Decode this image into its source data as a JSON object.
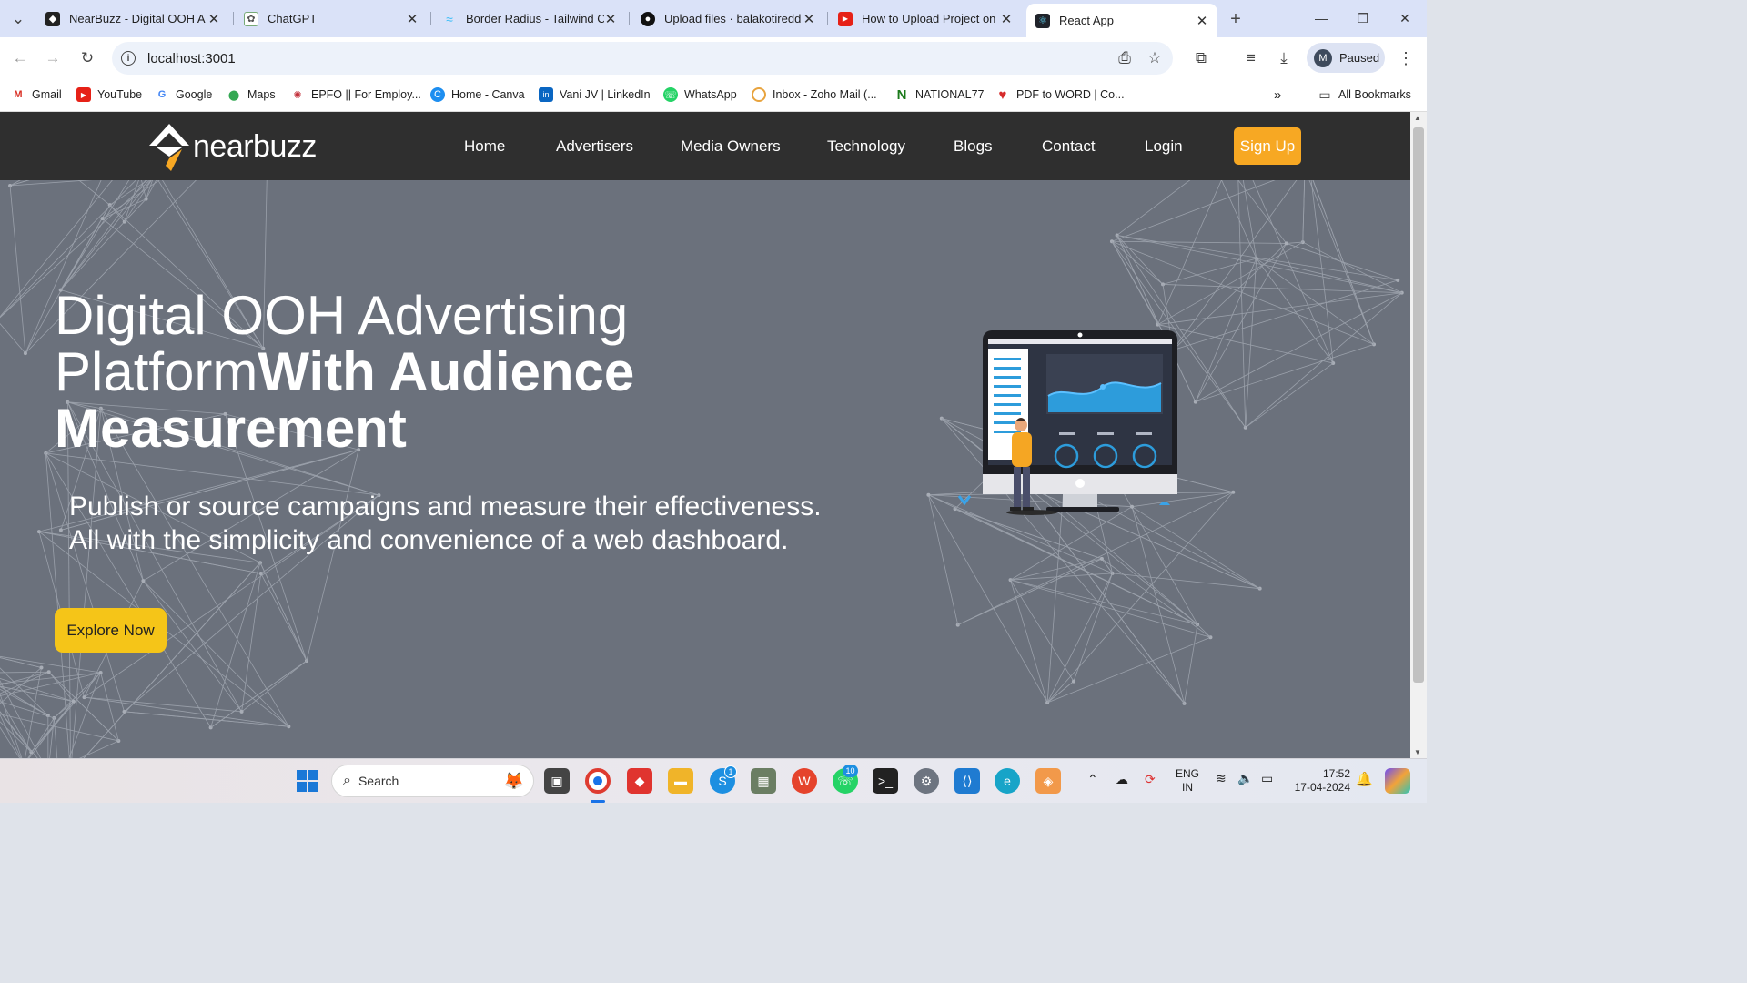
{
  "browser": {
    "tabs": [
      {
        "title": "NearBuzz - Digital OOH A",
        "icon": "nearbuzz-logo-icon"
      },
      {
        "title": "ChatGPT",
        "icon": "chatgpt-icon"
      },
      {
        "title": "Border Radius - Tailwind C",
        "icon": "tailwind-icon"
      },
      {
        "title": "Upload files · balakotiredd",
        "icon": "github-icon"
      },
      {
        "title": "How to Upload Project on",
        "icon": "youtube-icon"
      },
      {
        "title": "React App",
        "icon": "react-icon"
      }
    ],
    "url": "localhost:3001",
    "profile": {
      "initial": "M",
      "status": "Paused"
    },
    "bookmarks": [
      "Gmail",
      "YouTube",
      "Google",
      "Maps",
      "EPFO || For Employ...",
      "Home - Canva",
      "Vani JV | LinkedIn",
      "WhatsApp",
      "Inbox - Zoho Mail (...",
      "NATIONAL77",
      "PDF to WORD | Co..."
    ],
    "all_bookmarks": "All Bookmarks"
  },
  "site": {
    "logo_text": "nearbuzz",
    "nav": [
      "Home",
      "Advertisers",
      "Media Owners",
      "Technology",
      "Blogs",
      "Contact",
      "Login"
    ],
    "signup": "Sign Up",
    "hero": {
      "line1": "Digital OOH Advertising",
      "line2_light": "Platform",
      "line2_bold": "With Audience",
      "line3_bold": "Measurement",
      "sub1": "Publish or source campaigns and measure their effectiveness.",
      "sub2": "All with the simplicity and convenience of a web dashboard.",
      "cta": "Explore Now"
    },
    "accent": "#f7a823",
    "cta_color": "#f5c518"
  },
  "taskbar": {
    "search": "Search",
    "language": "ENG",
    "region": "IN",
    "time": "17:52",
    "date": "17-04-2024",
    "badges": {
      "skype": "1",
      "whatsapp": "10"
    }
  }
}
